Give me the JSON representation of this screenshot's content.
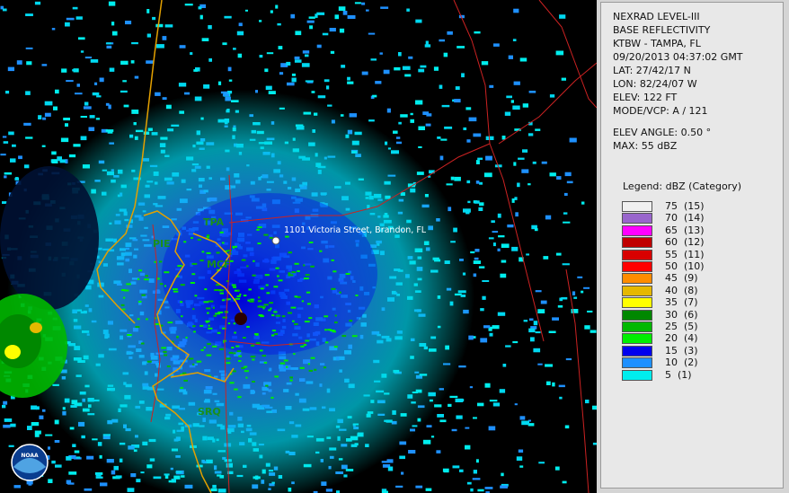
{
  "info": {
    "lines": [
      "NEXRAD LEVEL-III",
      "BASE REFLECTIVITY",
      "KTBW - TAMPA, FL",
      "09/20/2013 04:37:02 GMT",
      "LAT: 27/42/17 N",
      "LON: 82/24/07 W",
      "ELEV: 122 FT",
      "MODE/VCP: A / 121"
    ],
    "elev_angle": "ELEV ANGLE: 0.50 °",
    "max": "MAX: 55 dBZ"
  },
  "legend": {
    "title": "Legend: dBZ (Category)",
    "entries": [
      {
        "label": "75  (15)",
        "color": "#f0f0f0"
      },
      {
        "label": "70  (14)",
        "color": "#9966cc"
      },
      {
        "label": "65  (13)",
        "color": "#ff00ff"
      },
      {
        "label": "60  (12)",
        "color": "#c00000"
      },
      {
        "label": "55  (11)",
        "color": "#d80000"
      },
      {
        "label": "50  (10)",
        "color": "#ff0000"
      },
      {
        "label": "45  (9)",
        "color": "#ff8c00"
      },
      {
        "label": "40  (8)",
        "color": "#e6b800"
      },
      {
        "label": "35  (7)",
        "color": "#ffff00"
      },
      {
        "label": "30  (6)",
        "color": "#008800"
      },
      {
        "label": "25  (5)",
        "color": "#00b800"
      },
      {
        "label": "20  (4)",
        "color": "#00ee00"
      },
      {
        "label": "15  (3)",
        "color": "#0000ee"
      },
      {
        "label": "10  (2)",
        "color": "#1e90ff"
      },
      {
        "label": "5  (1)",
        "color": "#00eeee"
      }
    ]
  },
  "map": {
    "stations": [
      "TPA",
      "PIE",
      "MCF",
      "SRQ"
    ],
    "address": "1101 Victoria Street, Brandon, FL",
    "logo_text": "NOAA"
  }
}
